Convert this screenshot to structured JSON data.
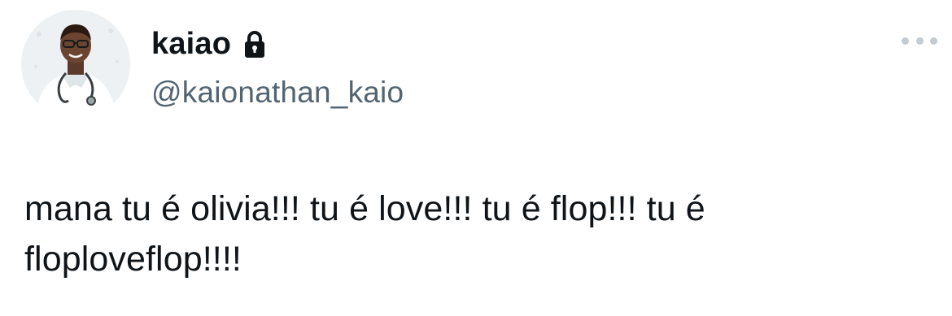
{
  "tweet": {
    "author": {
      "display_name": "kaiao",
      "handle": "@kaionathan_kaio",
      "avatar_icon": "profile-photo",
      "protected_icon": "lock-icon"
    },
    "more_icon": "more-dots-icon",
    "text_line_1": "mana tu é olivia!!! tu é love!!! tu é flop!!! tu é",
    "text_line_2": "floploveflop!!!!"
  },
  "colors": {
    "text": "#0f1419",
    "secondary_text": "#536471",
    "more_dots": "#c4cbd1",
    "background": "#ffffff"
  }
}
